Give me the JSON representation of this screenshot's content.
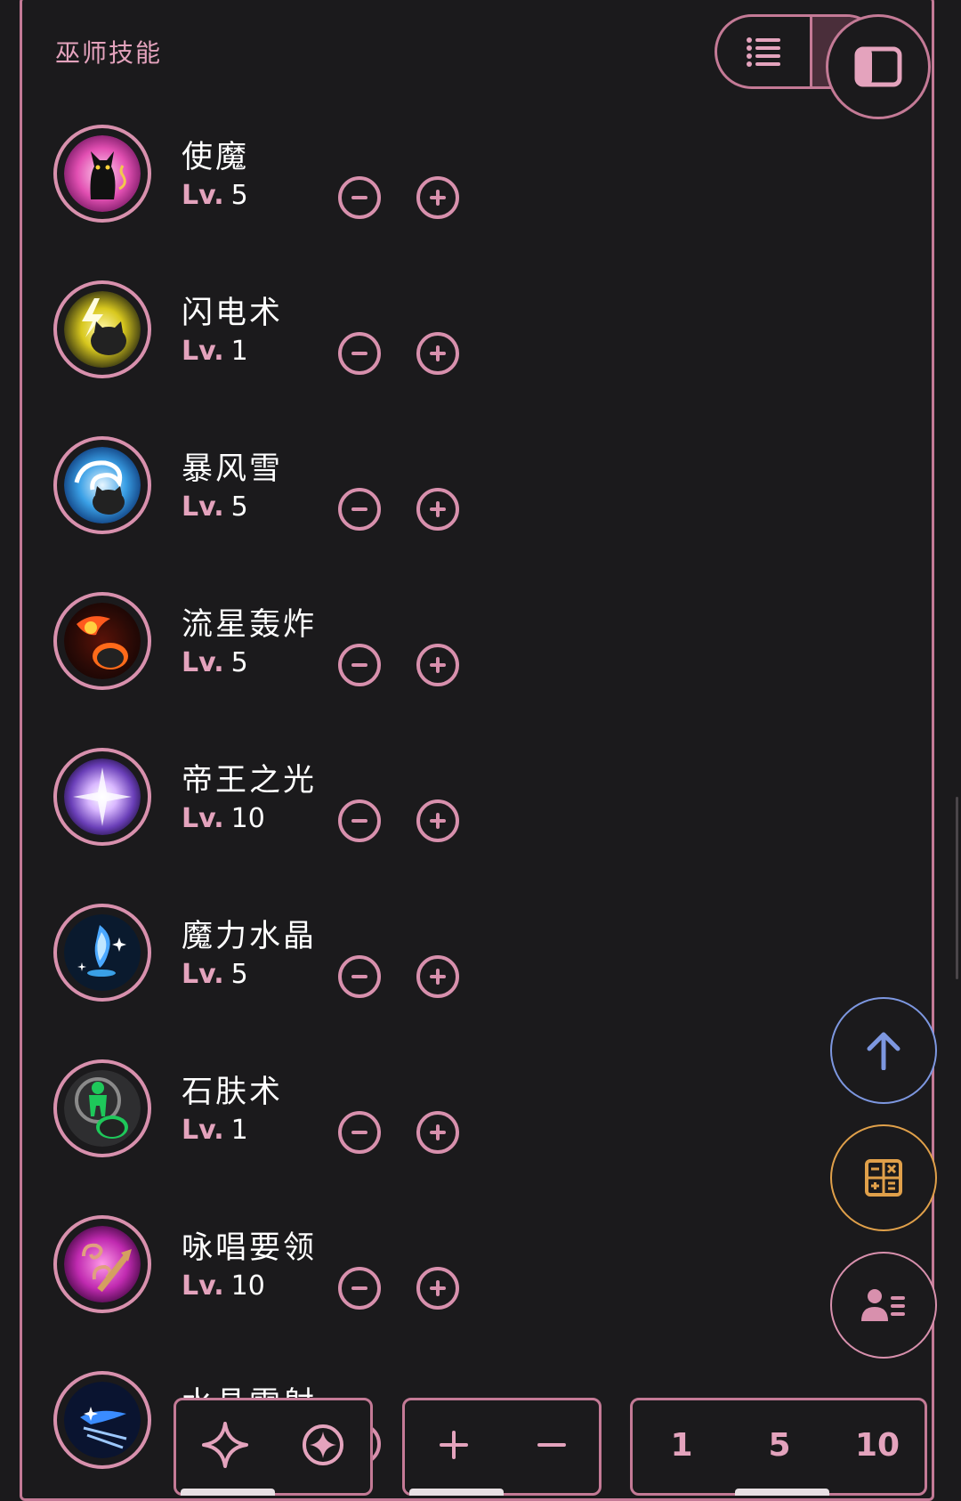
{
  "section_title": "巫师技能",
  "level_prefix": "Lv.",
  "skills": [
    {
      "name": "使魔",
      "level": "5",
      "icon": "cat-familiar-icon"
    },
    {
      "name": "闪电术",
      "level": "1",
      "icon": "lightning-cat-icon"
    },
    {
      "name": "暴风雪",
      "level": "5",
      "icon": "blizzard-cat-icon"
    },
    {
      "name": "流星轰炸",
      "level": "5",
      "icon": "meteor-cat-icon"
    },
    {
      "name": "帝王之光",
      "level": "10",
      "icon": "imperial-light-icon"
    },
    {
      "name": "魔力水晶",
      "level": "5",
      "icon": "mana-crystal-icon"
    },
    {
      "name": "石肤术",
      "level": "1",
      "icon": "stoneskin-cat-icon"
    },
    {
      "name": "咏唱要领",
      "level": "10",
      "icon": "chant-essence-icon"
    },
    {
      "name": "水晶雷射",
      "level": "",
      "icon": "crystal-laser-icon"
    }
  ],
  "bottom_bar": {
    "mode_icons": [
      "sparkle-icon",
      "compass-star-icon"
    ],
    "step_icons": [
      "plus-icon",
      "minus-icon"
    ],
    "amounts": [
      "1",
      "5",
      "10"
    ]
  },
  "fabs": [
    "arrow-up-icon",
    "calculator-icon",
    "user-list-icon"
  ],
  "colors": {
    "accent": "#d890ad",
    "background": "#1b1a1c",
    "fab_blue": "#7d97e0",
    "fab_orange": "#e0a04a"
  }
}
